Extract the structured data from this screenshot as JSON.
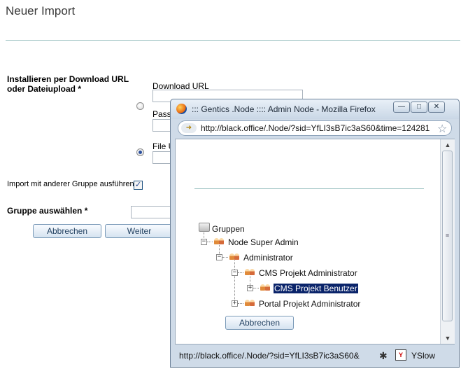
{
  "page": {
    "title": "Neuer Import",
    "install_label": "Installieren per Download URL oder Dateiupload *",
    "download_url_label": "Download URL",
    "password_label": "Passw",
    "file_label": "File U",
    "import_group_label": "Import mit anderer Gruppe ausführen",
    "import_group_checked": "✓",
    "group_label": "Gruppe auswählen *",
    "cancel_button": "Abbrechen",
    "next_button": "Weiter"
  },
  "popup": {
    "title": "::: Gentics .Node :::: Admin Node - Mozilla Firefox",
    "url": "http://black.office/.Node/?sid=YfLI3sB7ic3aS60&time=124281",
    "status_url": "http://black.office/.Node/?sid=YfLI3sB7ic3aS60&",
    "yslow": "YSlow",
    "minimize": "—",
    "maximize": "□",
    "close": "✕",
    "tree": {
      "root": "Gruppen",
      "items": [
        {
          "label": "Node Super Admin"
        },
        {
          "label": "Administrator"
        },
        {
          "label": "CMS Projekt Administrator"
        },
        {
          "label": "CMS Projekt Benutzer",
          "selected": true
        },
        {
          "label": "Portal Projekt Administrator"
        }
      ]
    },
    "cancel_button": "Abbrechen"
  },
  "colors": {
    "accent": "#0a246a",
    "rule": "#9fc4c4",
    "button_text": "#1f3f5f"
  }
}
